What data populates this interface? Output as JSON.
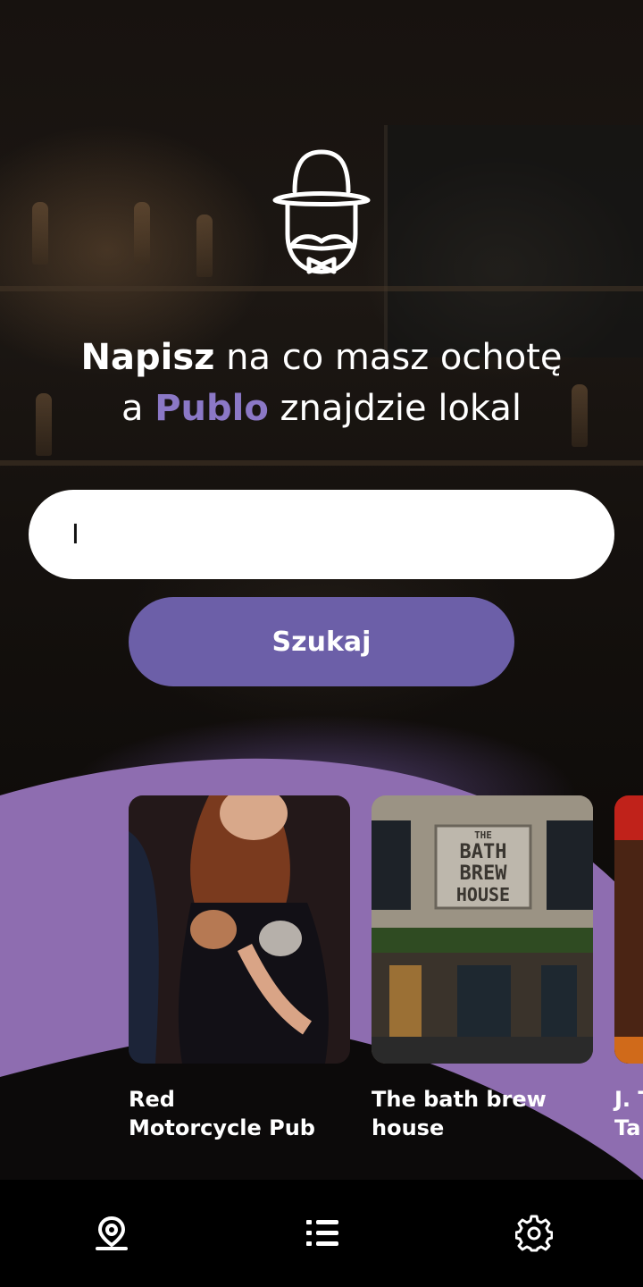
{
  "headline": {
    "line1_bold": "Napisz",
    "line1_rest": " na co masz ochotę",
    "line2_prefix": "a ",
    "line2_brand": "Publo",
    "line2_rest": " znajdzie lokal"
  },
  "search": {
    "value": "I",
    "button_label": "Szukaj"
  },
  "venues": [
    {
      "name": "Red Motorcycle Pub",
      "line1": "Red",
      "line2": "Motorcycle Pub"
    },
    {
      "name": "The bath brew house",
      "line1": "The bath brew",
      "line2": "house",
      "sign": [
        "THE",
        "BATH",
        "BREW",
        "HOUSE"
      ]
    },
    {
      "name": "J. T... Ta...",
      "line1": "J. T",
      "line2": "Ta"
    }
  ],
  "nav": {
    "items": [
      {
        "icon": "map-pin-icon"
      },
      {
        "icon": "list-icon"
      },
      {
        "icon": "gear-icon"
      }
    ]
  },
  "colors": {
    "accent": "#6c5fa8",
    "brand_text": "#8b78c6",
    "wave": "#8e6db0"
  }
}
